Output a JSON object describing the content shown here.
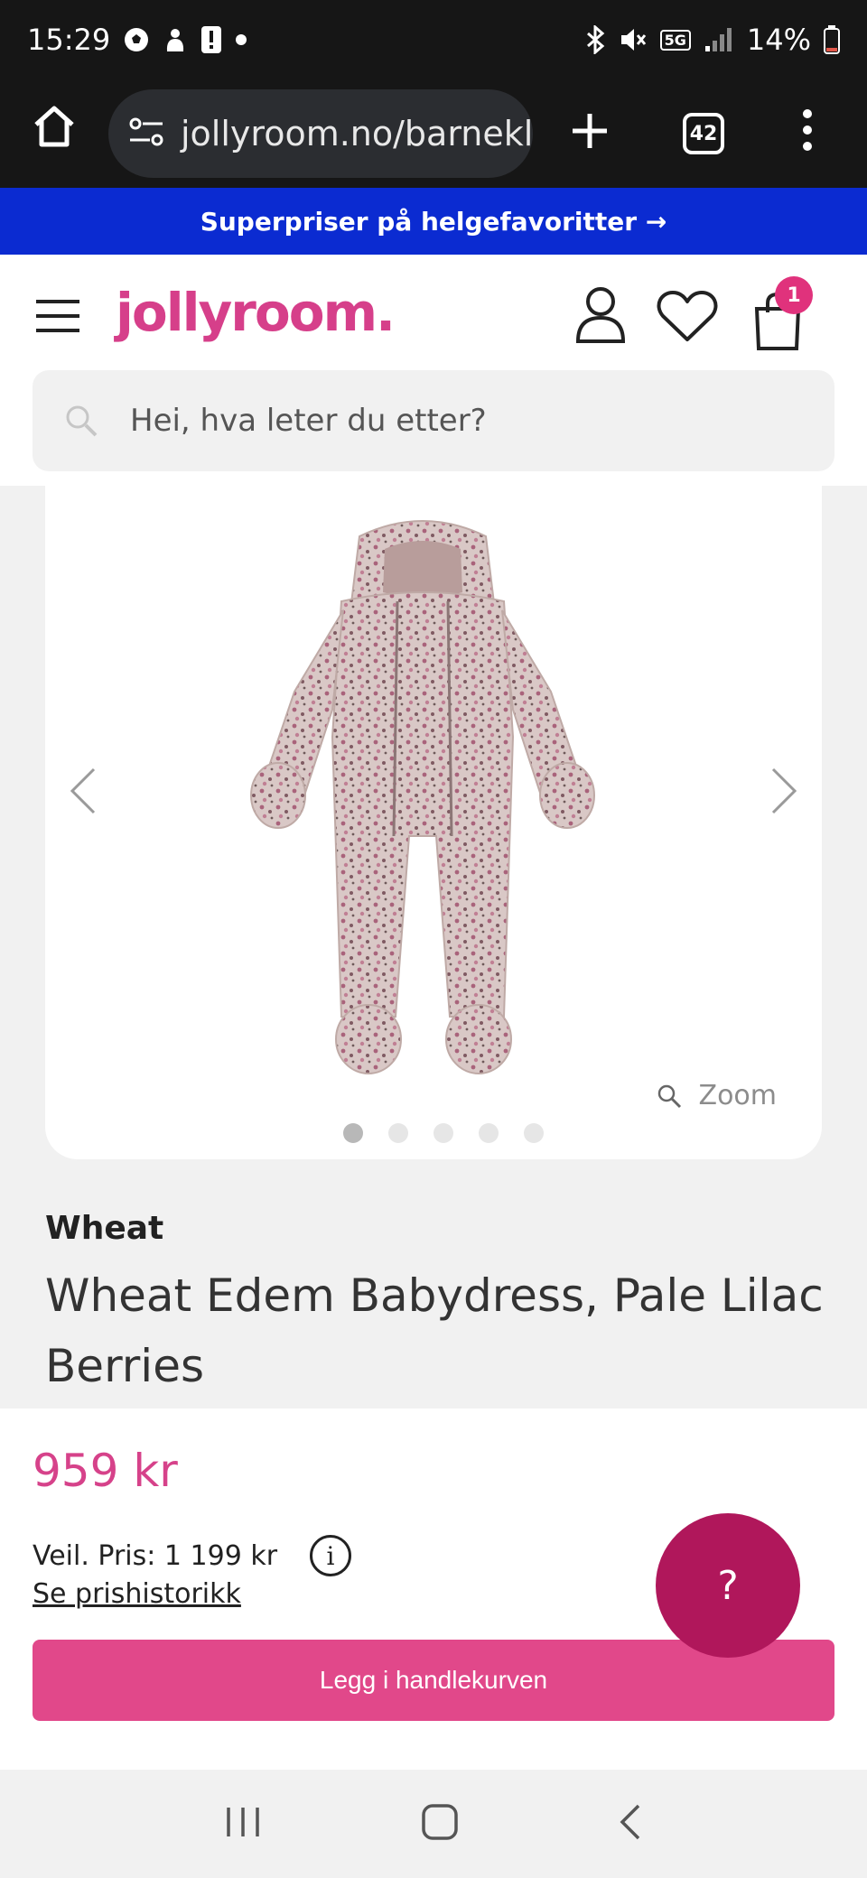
{
  "status_bar": {
    "time": "15:29",
    "battery": "14%",
    "network_badge": "5G",
    "icons": [
      "soccer-ball-icon",
      "hand-icon",
      "alert-icon",
      "dot-icon",
      "bluetooth-icon",
      "mute-icon",
      "signal-icon",
      "battery-icon"
    ]
  },
  "browser": {
    "url": "jollyroom.no/barnekl",
    "tab_count": "42"
  },
  "promo_banner": {
    "text": "Superpriser på helgefavoritter →"
  },
  "header": {
    "logo": "jollyroom.",
    "cart_count": "1",
    "search_placeholder": "Hei, hva leter du etter?"
  },
  "gallery": {
    "zoom_label": "Zoom",
    "image_count": 5,
    "active_index": 0
  },
  "product": {
    "brand": "Wheat",
    "title": "Wheat Edem Babydress, Pale Lilac Berries",
    "price": "959 kr",
    "rrp": "Veil. Pris: 1 199 kr",
    "history_link": "Se prishistorikk",
    "add_to_cart": "Legg i handlekurven",
    "help": "?"
  },
  "colors": {
    "brand_pink": "#d63f8a",
    "banner_blue": "#0b2bd1",
    "help_magenta": "#b0175b",
    "button_pink": "#e1488a"
  }
}
